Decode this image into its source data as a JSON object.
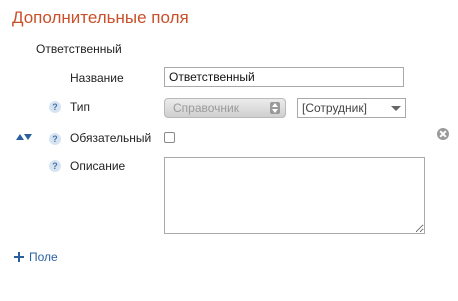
{
  "page": {
    "title": "Дополнительные поля"
  },
  "field": {
    "name": "Ответственный",
    "rows": {
      "name_label": "Название",
      "name_value": "Ответственный",
      "type_label": "Тип",
      "type_value": "Справочник",
      "type_subvalue": "[Сотрудник]",
      "required_label": "Обязательный",
      "required_checked": false,
      "description_label": "Описание",
      "description_value": ""
    },
    "help_glyph": "?"
  },
  "actions": {
    "add_field_label": "Поле"
  },
  "colors": {
    "title": "#c8502a",
    "link": "#2a5fa0",
    "move_icon": "#2a5fa0",
    "help_icon_bg": "#d6e4f2"
  },
  "icons": {
    "move": "move-up-down-icon",
    "help": "help-icon",
    "delete": "delete-icon",
    "add": "plus-icon"
  }
}
